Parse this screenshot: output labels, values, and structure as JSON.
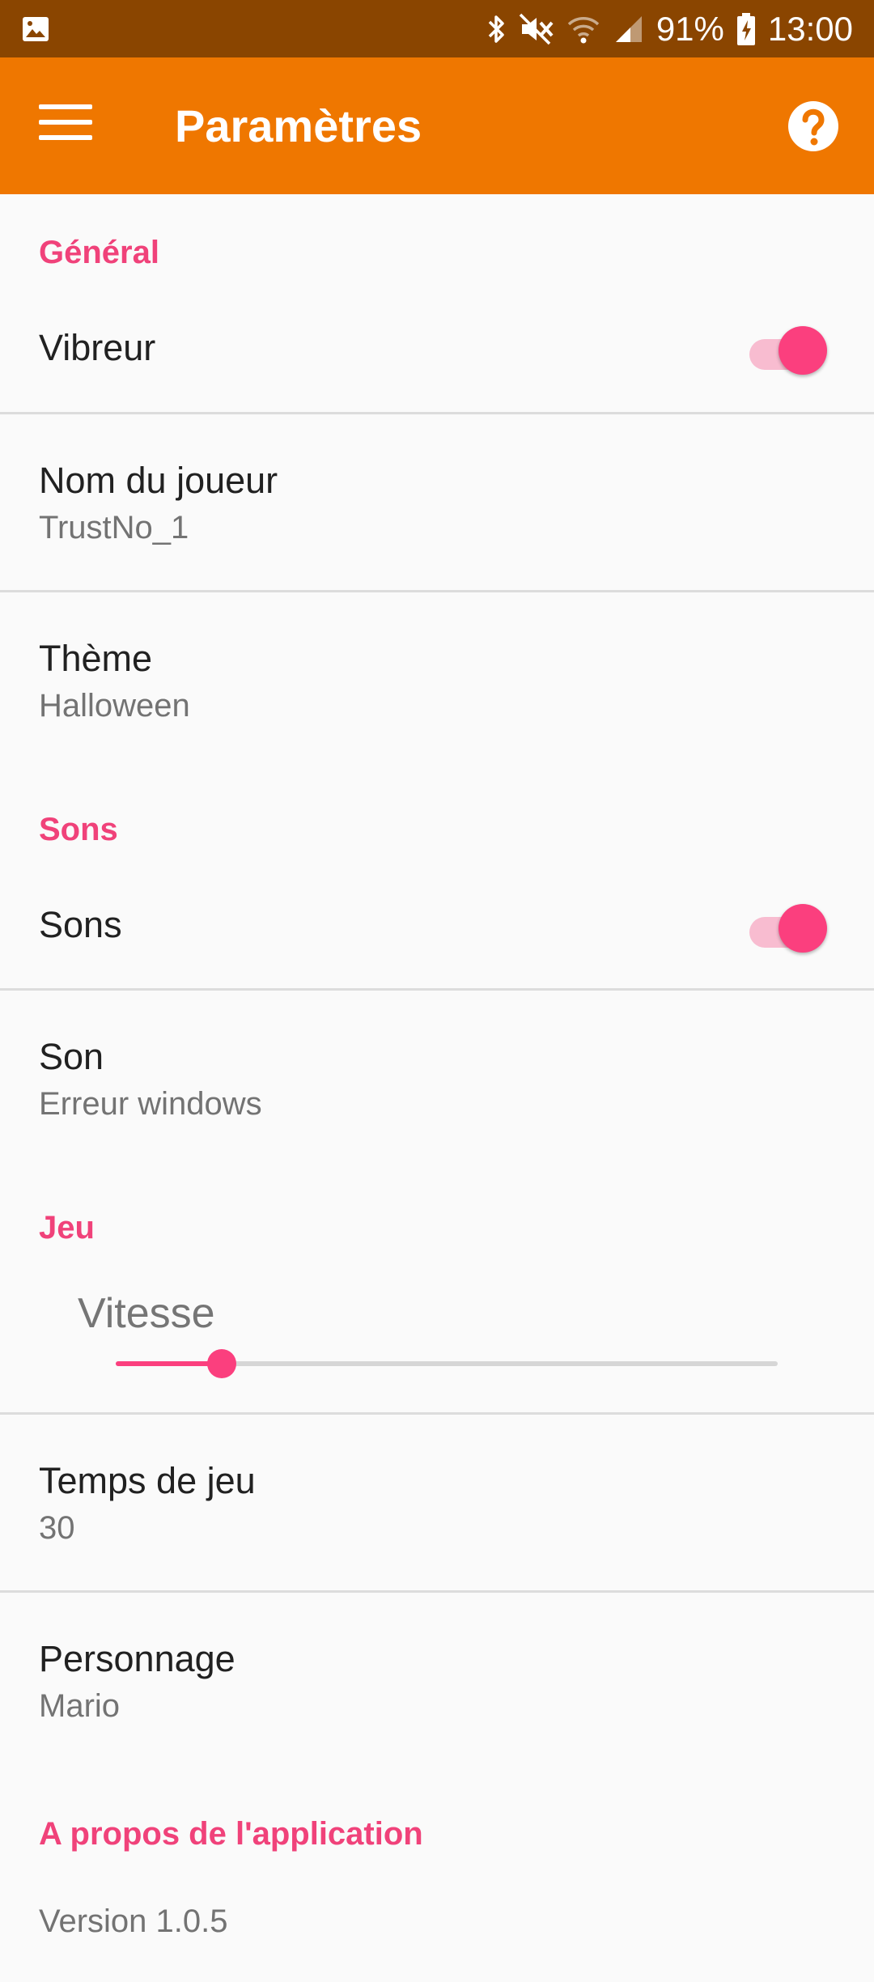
{
  "status_bar": {
    "battery": "91%",
    "time": "13:00",
    "icons": [
      "gallery-icon",
      "bluetooth-icon",
      "mute-icon",
      "wifi-icon",
      "signal-icon",
      "battery-charging-icon"
    ]
  },
  "app_bar": {
    "title": "Paramètres",
    "menu_icon": "hamburger-menu-icon",
    "help_icon": "help-circle-icon"
  },
  "colors": {
    "status_bar": "#8a4500",
    "app_bar": "#ef7700",
    "accent": "#fb3f7e",
    "category": "#f0427a"
  },
  "sections": {
    "general": {
      "header": "Général",
      "vibreur": {
        "title": "Vibreur",
        "on": true
      },
      "nom_joueur": {
        "title": "Nom du joueur",
        "summary": "TrustNo_1"
      },
      "theme": {
        "title": "Thème",
        "summary": "Halloween"
      }
    },
    "sons": {
      "header": "Sons",
      "sons_toggle": {
        "title": "Sons",
        "on": true
      },
      "son": {
        "title": "Son",
        "summary": "Erreur windows"
      }
    },
    "jeu": {
      "header": "Jeu",
      "vitesse": {
        "label": "Vitesse",
        "fraction": 0.16
      },
      "temps": {
        "title": "Temps de jeu",
        "summary": "30"
      },
      "personnage": {
        "title": "Personnage",
        "summary": "Mario"
      }
    },
    "about": {
      "header": "A propos de l'application",
      "version": "Version 1.0.5"
    }
  }
}
